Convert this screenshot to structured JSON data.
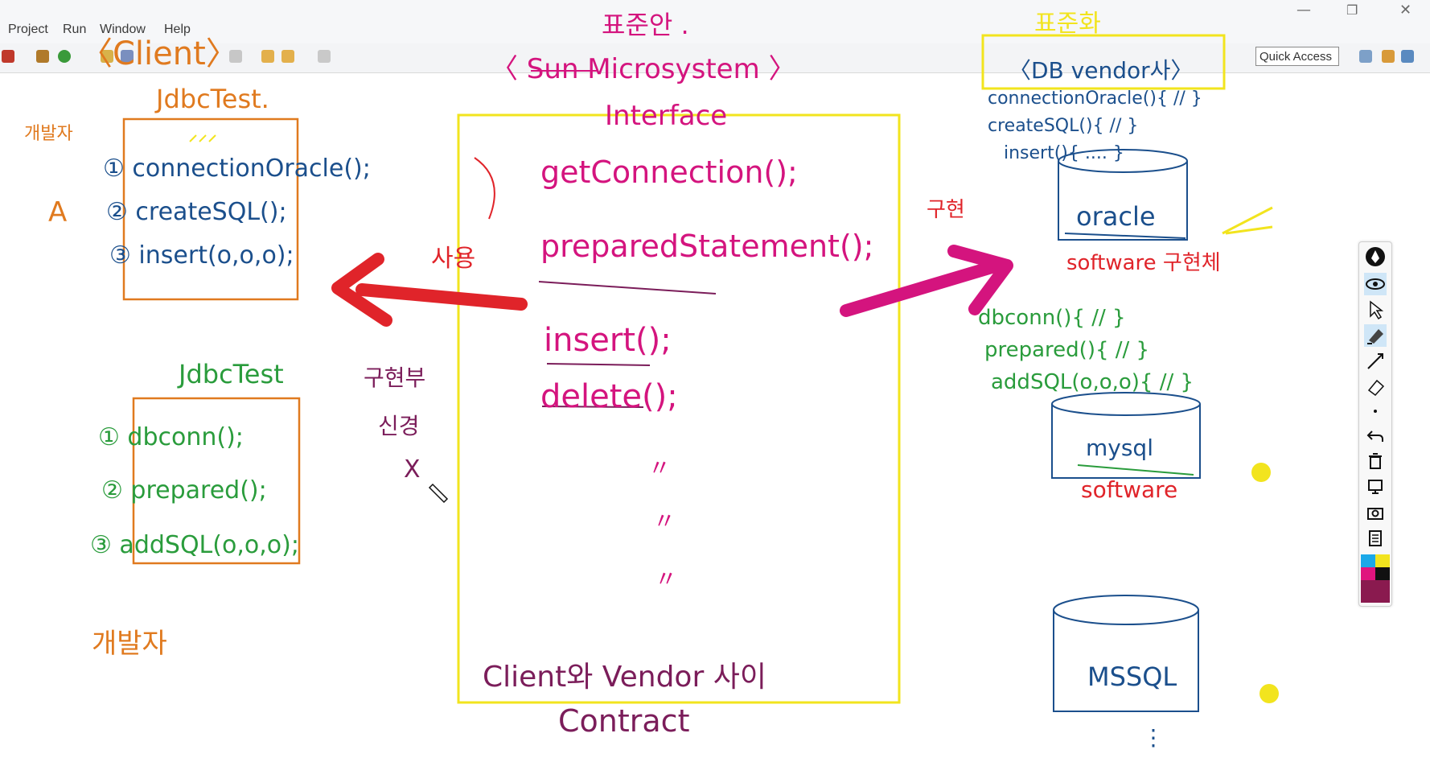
{
  "menu": {
    "items": [
      "Project",
      "Run",
      "Window",
      "Help"
    ]
  },
  "window_controls": {
    "minimize": "—",
    "restore": "❐",
    "close": "✕"
  },
  "toolbar": {
    "quick_access": "Quick Access"
  },
  "ink": {
    "title_standard": "표준안 .",
    "sun": "〈 Sun Microsystem 〉",
    "interface": "Interface",
    "client": "〈Client〉",
    "jdbctest1": "JdbcTest.",
    "developer1": "개발자",
    "label_a": "A",
    "c1": "① connectionOracle();",
    "c2": "② createSQL();",
    "c3": "③ insert(o,o,o);",
    "use": "사용",
    "jdbctest2": "JdbcTest",
    "m1": "① dbconn();",
    "m2": "② prepared();",
    "m3": "③ addSQL(o,o,o);",
    "impl_change": "구현부",
    "new_": "신경",
    "x_mark": "X",
    "developer2": "개발자",
    "get_conn": "getConnection();",
    "prep_stmt": "preparedStatement();",
    "insert": "insert();",
    "delete": "delete();",
    "ditto": "〃",
    "contract_line": "Client와 Vendor 사이",
    "contract": "Contract",
    "standard_right": "표준화",
    "db_vendor": "〈DB vendor사〉",
    "v1": "connectionOracle(){ // }",
    "v2": "createSQL(){ // }",
    "v3": "insert(){ .... }",
    "implement": "구현",
    "oracle": "oracle",
    "software1": "software 구현체",
    "d1": "dbconn(){ // }",
    "d2": "prepared(){ // }",
    "d3": "addSQL(o,o,o){ // }",
    "mysql": "mysql",
    "software2": "software",
    "mssql": "MSSQL",
    "dots": "⋮"
  },
  "pen_tools": [
    "pen-icon",
    "eye-icon",
    "select-icon",
    "highlighter-icon",
    "line-icon",
    "eraser-icon",
    "dot-icon",
    "undo-icon",
    "trash-icon",
    "screen-icon",
    "camera-icon",
    "notes-icon"
  ],
  "colors": {
    "blue": "#1b4f8c",
    "orange": "#e07a1f",
    "green": "#2a9c3c",
    "magenta": "#d4147e",
    "purple": "#7b1d5a",
    "red": "#e0242a",
    "yellow": "#f2e41e"
  }
}
